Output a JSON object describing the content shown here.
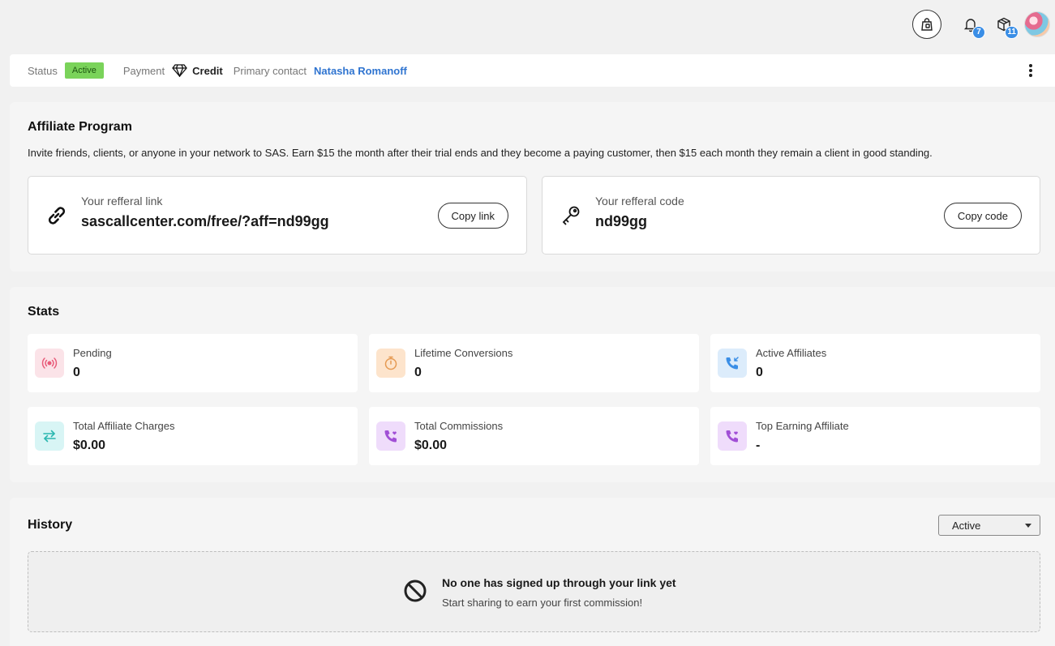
{
  "topbar": {
    "notifications_count": "7",
    "packages_count": "11",
    "icons": [
      "store-lock-icon",
      "bell-icon",
      "box-icon",
      "avatar"
    ]
  },
  "status": {
    "status_label": "Status",
    "status_value": "Active",
    "payment_label": "Payment",
    "payment_value": "Credit",
    "contact_label": "Primary contact",
    "contact_value": "Natasha Romanoff"
  },
  "affiliate": {
    "title": "Affiliate Program",
    "description": "Invite friends, clients, or anyone in your network to SAS. Earn $15 the month after their trial ends and they become a paying customer, then $15 each month they remain a client in good standing.",
    "link_card": {
      "label": "Your refferal link",
      "value": "sascallcenter.com/free/?aff=nd99gg",
      "button": "Copy link"
    },
    "code_card": {
      "label": "Your refferal code",
      "value": "nd99gg",
      "button": "Copy code"
    }
  },
  "stats": {
    "title": "Stats",
    "items": [
      {
        "label": "Pending",
        "value": "0",
        "icon": "broadcast-icon",
        "color": "#e85c7a",
        "bg": "#fbe3e8"
      },
      {
        "label": "Lifetime Conversions",
        "value": "0",
        "icon": "stopwatch-icon",
        "color": "#e59a52",
        "bg": "#fde4cc"
      },
      {
        "label": "Active Affiliates",
        "value": "0",
        "icon": "incoming-call-icon",
        "color": "#3a8ee6",
        "bg": "#dcecfb"
      },
      {
        "label": "Total Affiliate Charges",
        "value": "$0.00",
        "icon": "swap-arrows-icon",
        "color": "#2bb7b0",
        "bg": "#d8f5f5"
      },
      {
        "label": "Total Commissions",
        "value": "$0.00",
        "icon": "phone-heart-icon",
        "color": "#a14fd6",
        "bg": "#efdcfb"
      },
      {
        "label": "Top Earning Affiliate",
        "value": "-",
        "icon": "phone-heart-icon",
        "color": "#a14fd6",
        "bg": "#efdcfb"
      }
    ]
  },
  "history": {
    "title": "History",
    "filter_value": "Active",
    "empty_title": "No one has signed up through your link yet",
    "empty_subtitle": "Start sharing to earn your first commission!"
  }
}
